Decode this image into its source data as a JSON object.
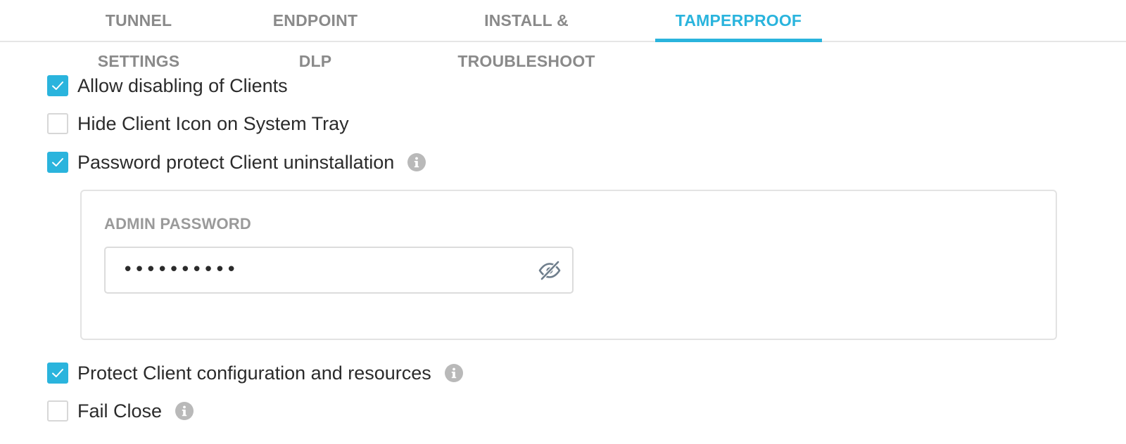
{
  "tabs": [
    {
      "label": "TUNNEL SETTINGS",
      "active": false
    },
    {
      "label": "ENDPOINT DLP",
      "active": false
    },
    {
      "label": "INSTALL & TROUBLESHOOT",
      "active": false
    },
    {
      "label": "TAMPERPROOF",
      "active": true
    }
  ],
  "options": {
    "allow_disabling": {
      "label": "Allow disabling of Clients",
      "checked": true
    },
    "hide_icon": {
      "label": "Hide Client Icon on System Tray",
      "checked": false
    },
    "password_protect": {
      "label": "Password protect Client uninstallation",
      "checked": true,
      "info_icon": "info-icon"
    },
    "protect_config": {
      "label": "Protect Client configuration and resources",
      "checked": true,
      "info_icon": "info-icon"
    },
    "fail_close": {
      "label": "Fail Close",
      "checked": false,
      "info_icon": "info-icon"
    }
  },
  "admin_password": {
    "label": "ADMIN PASSWORD",
    "value": "••••••••••",
    "toggle_icon": "eye-slash-icon"
  },
  "colors": {
    "accent": "#2ab4dd",
    "tab_inactive": "#8a8a8a",
    "info_icon": "#b9b9b9"
  }
}
